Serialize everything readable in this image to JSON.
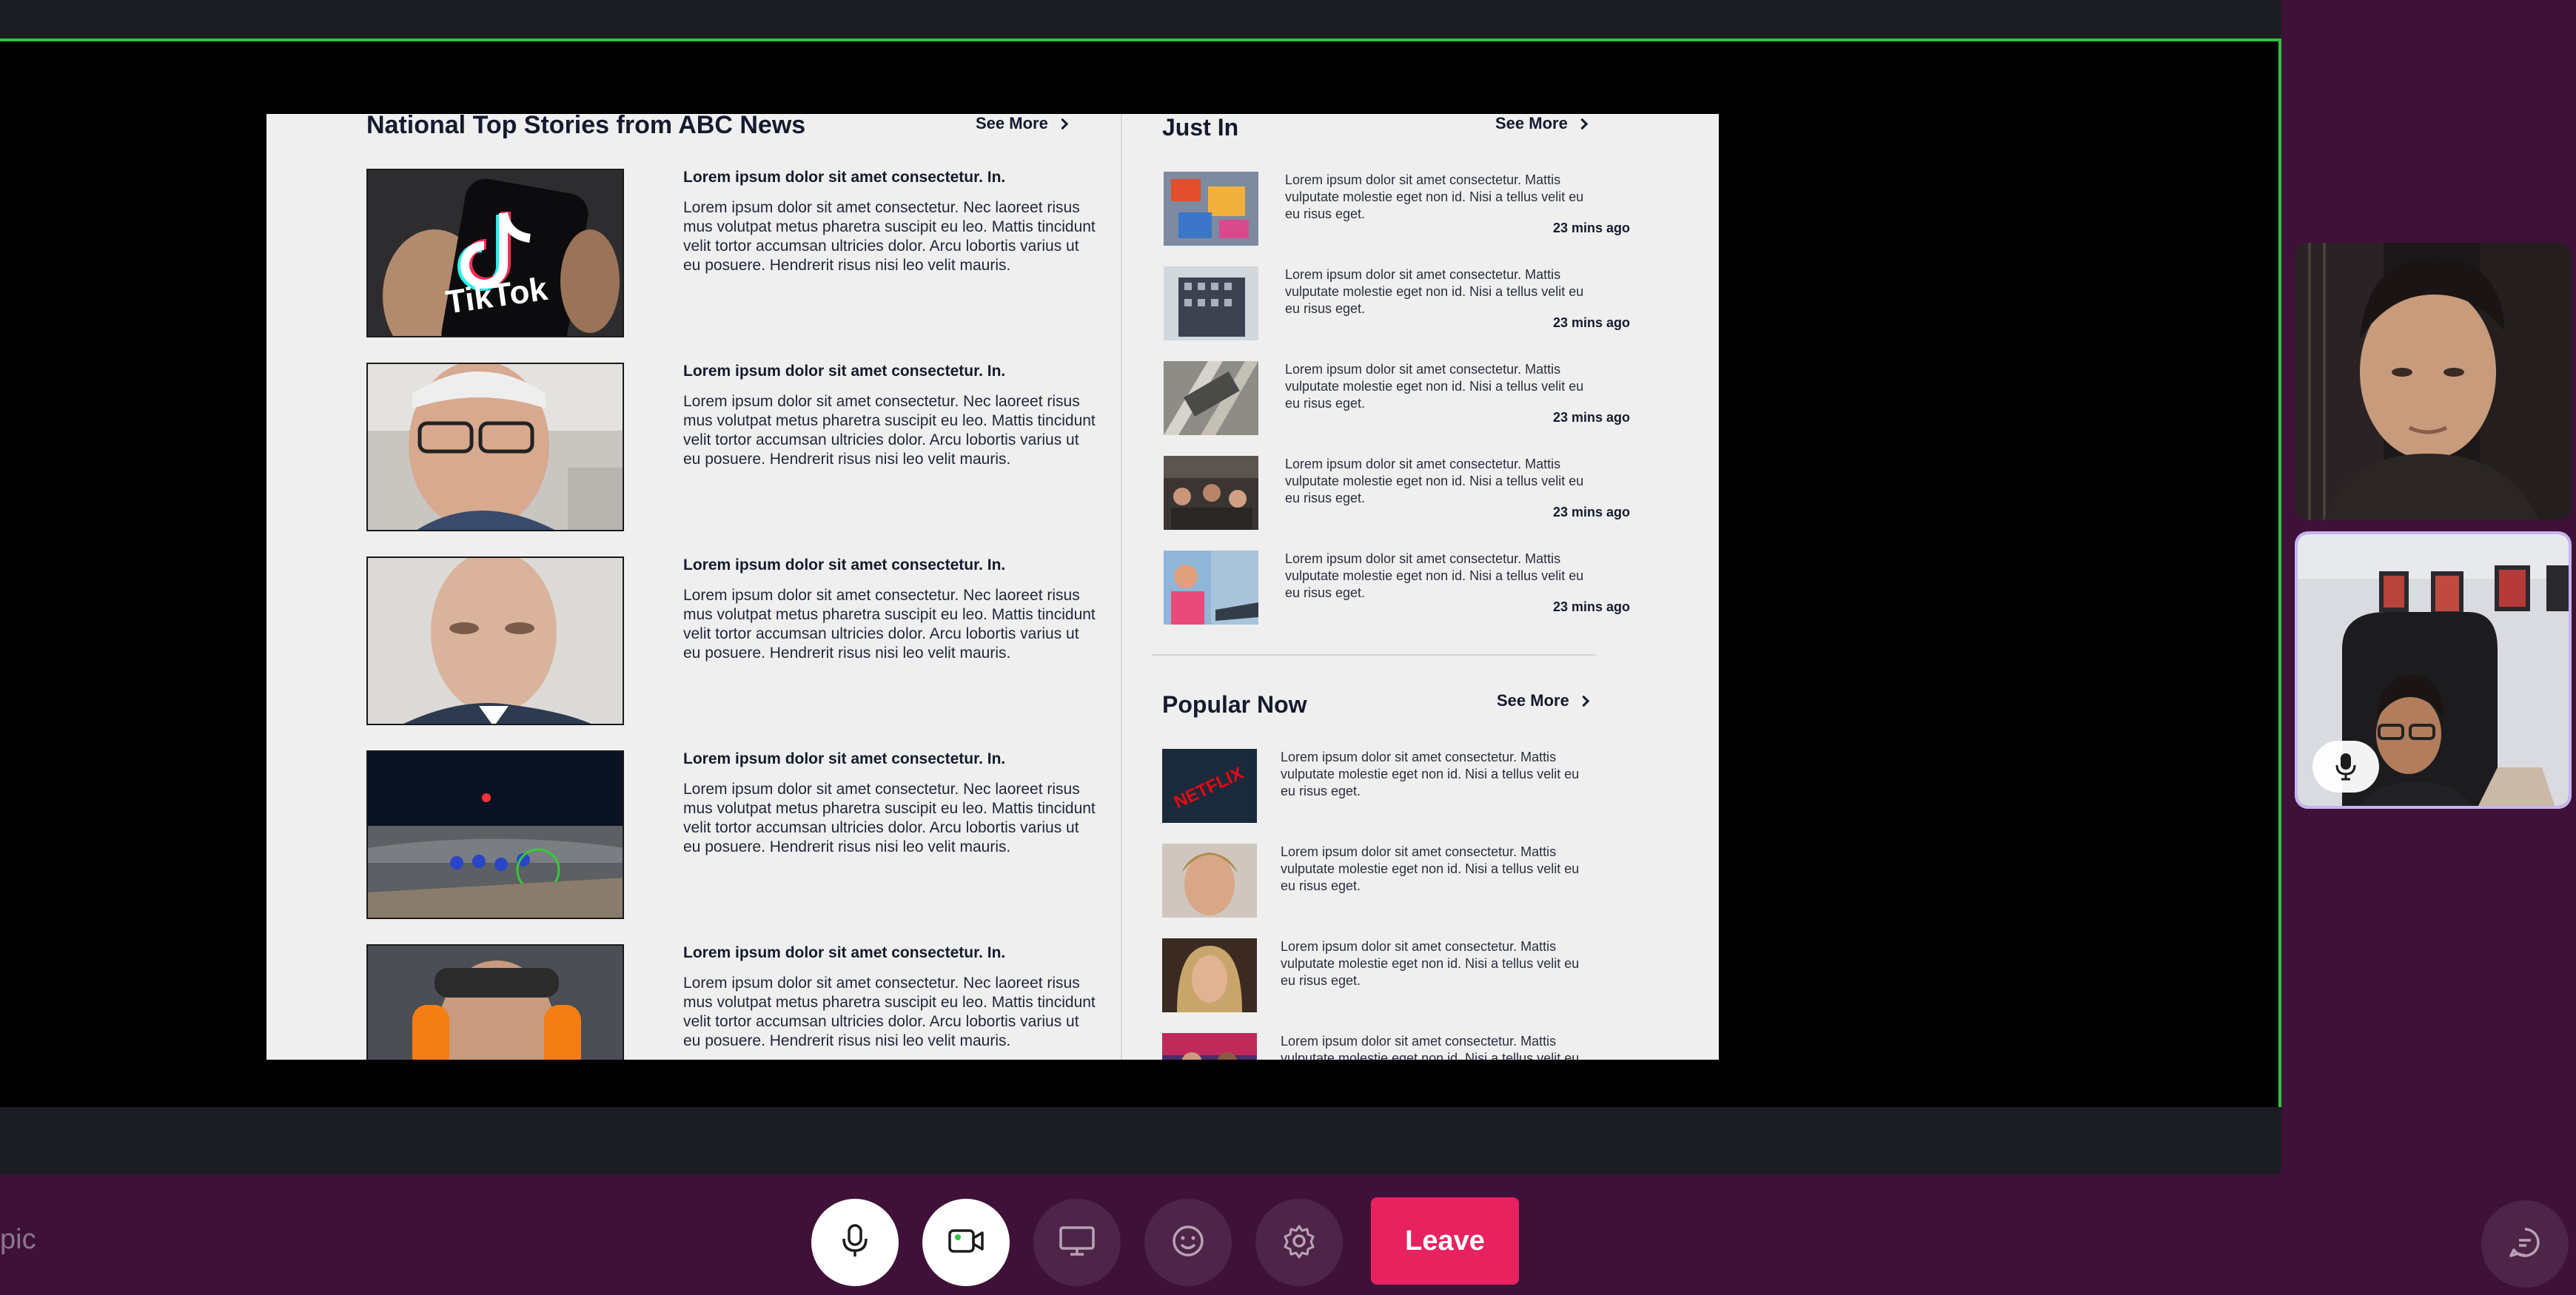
{
  "meeting": {
    "topic_fragment": "pic"
  },
  "shared_page": {
    "top_stories": {
      "title": "National Top Stories from ABC News",
      "see_more": "See More",
      "items": [
        {
          "headline": "Lorem ipsum dolor sit amet consectetur. In.",
          "body": "Lorem ipsum dolor sit amet consectetur. Nec laoreet risus mus volutpat metus pharetra suscipit eu leo. Mattis tincidunt velit tortor accumsan ultricies dolor. Arcu lobortis varius ut eu posuere. Hendrerit risus nisi leo velit mauris.",
          "image_text": "TikTok"
        },
        {
          "headline": "Lorem ipsum dolor sit amet consectetur. In.",
          "body": "Lorem ipsum dolor sit amet consectetur. Nec laoreet risus mus volutpat metus pharetra suscipit eu leo. Mattis tincidunt velit tortor accumsan ultricies dolor. Arcu lobortis varius ut eu posuere. Hendrerit risus nisi leo velit mauris."
        },
        {
          "headline": "Lorem ipsum dolor sit amet consectetur. In.",
          "body": "Lorem ipsum dolor sit amet consectetur. Nec laoreet risus mus volutpat metus pharetra suscipit eu leo. Mattis tincidunt velit tortor accumsan ultricies dolor. Arcu lobortis varius ut eu posuere. Hendrerit risus nisi leo velit mauris."
        },
        {
          "headline": "Lorem ipsum dolor sit amet consectetur. In.",
          "body": "Lorem ipsum dolor sit amet consectetur. Nec laoreet risus mus volutpat metus pharetra suscipit eu leo. Mattis tincidunt velit tortor accumsan ultricies dolor. Arcu lobortis varius ut eu posuere. Hendrerit risus nisi leo velit mauris."
        },
        {
          "headline": "Lorem ipsum dolor sit amet consectetur. In.",
          "body": "Lorem ipsum dolor sit amet consectetur. Nec laoreet risus mus volutpat metus pharetra suscipit eu leo. Mattis tincidunt velit tortor accumsan ultricies dolor. Arcu lobortis varius ut eu posuere. Hendrerit risus nisi leo velit mauris."
        }
      ]
    },
    "just_in": {
      "title": "Just In",
      "see_more": "See More",
      "items": [
        {
          "text": "Lorem ipsum dolor sit amet consectetur. Mattis vulputate molestie eget non id. Nisi a tellus velit eu eu risus eget.",
          "time": "23 mins ago"
        },
        {
          "text": "Lorem ipsum dolor sit amet consectetur. Mattis vulputate molestie eget non id. Nisi a tellus velit eu eu risus eget.",
          "time": "23 mins ago"
        },
        {
          "text": "Lorem ipsum dolor sit amet consectetur. Mattis vulputate molestie eget non id. Nisi a tellus velit eu eu risus eget.",
          "time": "23 mins ago"
        },
        {
          "text": "Lorem ipsum dolor sit amet consectetur. Mattis vulputate molestie eget non id. Nisi a tellus velit eu eu risus eget.",
          "time": "23 mins ago"
        },
        {
          "text": "Lorem ipsum dolor sit amet consectetur. Mattis vulputate molestie eget non id. Nisi a tellus velit eu eu risus eget.",
          "time": "23 mins ago"
        }
      ]
    },
    "popular_now": {
      "title": "Popular Now",
      "see_more": "See More",
      "items": [
        {
          "text": "Lorem ipsum dolor sit amet consectetur. Mattis vulputate molestie eget non id. Nisi a tellus velit eu eu risus eget.",
          "image_text": "NETFLIX"
        },
        {
          "text": "Lorem ipsum dolor sit amet consectetur. Mattis vulputate molestie eget non id. Nisi a tellus velit eu eu risus eget."
        },
        {
          "text": "Lorem ipsum dolor sit amet consectetur. Mattis vulputate molestie eget non id. Nisi a tellus velit eu eu risus eget."
        },
        {
          "text": "Lorem ipsum dolor sit amet consectetur. Mattis vulputate molestie eget non id. Nisi a tellus velit eu eu risus eget."
        }
      ]
    }
  },
  "controls": {
    "leave_label": "Leave",
    "icons": [
      "microphone-icon",
      "video-camera-icon",
      "screen-share-icon",
      "emoji-icon",
      "settings-icon",
      "chat-icon"
    ]
  },
  "colors": {
    "background": "#3f1138",
    "leave": "#e8215f",
    "share_border": "#2cc43d",
    "active_tile_border": "#c4b5f0"
  }
}
